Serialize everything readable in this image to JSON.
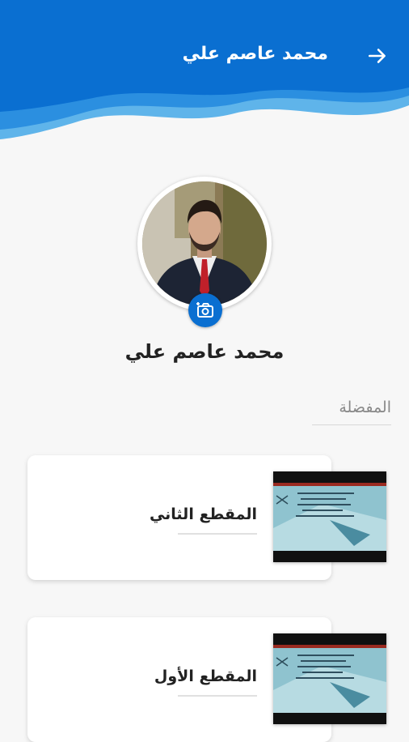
{
  "header": {
    "title": "محمد عاصم علي",
    "back_icon": "arrow-right-icon",
    "bg_color": "#0a6fd1"
  },
  "profile": {
    "name": "محمد عاصم علي",
    "camera_icon": "add-photo-icon"
  },
  "favorites": {
    "section_title": "المفضلة",
    "items": [
      {
        "title": "المقطع الثاني"
      },
      {
        "title": "المقطع الأول"
      }
    ]
  }
}
